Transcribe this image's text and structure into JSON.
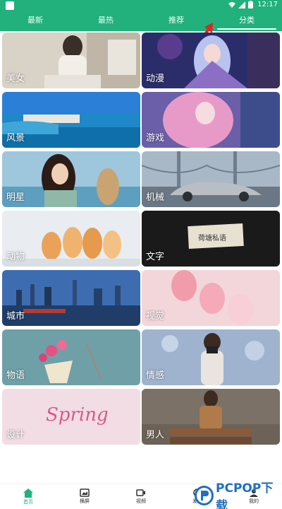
{
  "status_bar": {
    "time": "12:17"
  },
  "tabs": [
    {
      "label": "最新"
    },
    {
      "label": "最热"
    },
    {
      "label": "推荐"
    },
    {
      "label": "分类",
      "active": true
    }
  ],
  "categories": [
    {
      "label": "美女"
    },
    {
      "label": "动漫"
    },
    {
      "label": "风景"
    },
    {
      "label": "游戏"
    },
    {
      "label": "明星"
    },
    {
      "label": "机械"
    },
    {
      "label": "动物"
    },
    {
      "label": "文字"
    },
    {
      "label": "城市"
    },
    {
      "label": "视觉"
    },
    {
      "label": "物语"
    },
    {
      "label": "情感"
    },
    {
      "label": "设计"
    },
    {
      "label": "男人"
    }
  ],
  "card_texts": {
    "text_card_note": "荷塘私语",
    "design_script": "Spring"
  },
  "bottom_nav": [
    {
      "label": "首页",
      "icon": "home-icon",
      "active": true
    },
    {
      "label": "横屏",
      "icon": "landscape-icon"
    },
    {
      "label": "视频",
      "icon": "video-icon"
    },
    {
      "label": "发现",
      "icon": "discover-icon"
    },
    {
      "label": "我的",
      "icon": "profile-icon"
    }
  ],
  "watermark": {
    "text": "PCPOP下载"
  },
  "colors": {
    "brand_green": "#22b07d",
    "watermark_blue": "#1f6fc2"
  }
}
